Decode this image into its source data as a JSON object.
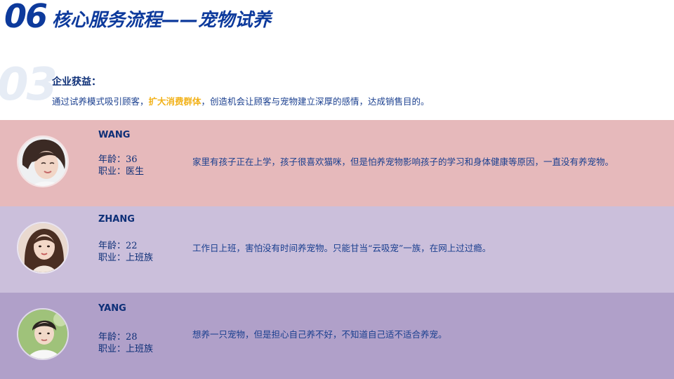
{
  "header": {
    "section_number": "06",
    "title": "核心服务流程——宠物试养"
  },
  "intro": {
    "ghost_number": "03",
    "heading": "企业获益：",
    "text_before": "通过试养模式吸引顾客，",
    "text_highlight": "扩大消费群体",
    "text_after": "，创造机会让顾客与宠物建立深厚的感情，达成销售目的。"
  },
  "personas": [
    {
      "name": "WANG",
      "age": "年龄：36",
      "job": "职业：医生",
      "description": "家里有孩子正在上学，孩子很喜欢猫咪，但是怕养宠物影响孩子的学习和身体健康等原因，一直没有养宠物。"
    },
    {
      "name": "ZHANG",
      "age": "年龄：22",
      "job": "职业：上班族",
      "description": "工作日上班，害怕没有时间养宠物。只能甘当“云吸宠”一族，在网上过过瘾。"
    },
    {
      "name": "YANG",
      "age": "年龄：28",
      "job": "职业：上班族",
      "description": "想养一只宠物，但是担心自己养不好，不知道自己适不适合养宠。"
    }
  ],
  "colors": {
    "primary_blue": "#0d3a9c",
    "highlight_yellow": "#f2b21a",
    "band_wang": "#e6b9bb",
    "band_zhang": "#cbbfdb",
    "band_yang": "#b0a0c9"
  }
}
